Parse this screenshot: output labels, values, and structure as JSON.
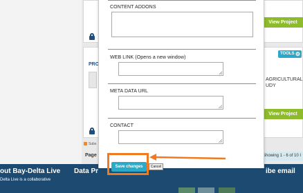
{
  "background": {
    "view_project_label": "View Project",
    "tools_label": "TOOLS",
    "project_prefix": "PRO",
    "project_title_line1": "AGRICULTURAL",
    "project_title_line2": "UDY",
    "subscribe_label": "Subs",
    "page_label": "Page",
    "showing_text": "Showing 1 - 6 of 10 I"
  },
  "footer": {
    "about_title": "out Bay-Delta Live",
    "about_sub": "Delta Live is a collaborative",
    "data_title": "Data Pr",
    "subscribe_title": "ibe email"
  },
  "modal": {
    "content_addons_label": "CONTENT ADDONS",
    "web_link_label": "WEB LINK (Opens a new window)",
    "meta_data_url_label": "META DATA URL",
    "contact_label": "CONTACT",
    "save_button_label": "Save changes",
    "cancel_button_label": "Cancel"
  },
  "colors": {
    "accent_green": "#8dbb2b",
    "accent_teal": "#2aa9c9",
    "footer_blue": "#1d4a70",
    "highlight_orange": "#f07a1f"
  }
}
